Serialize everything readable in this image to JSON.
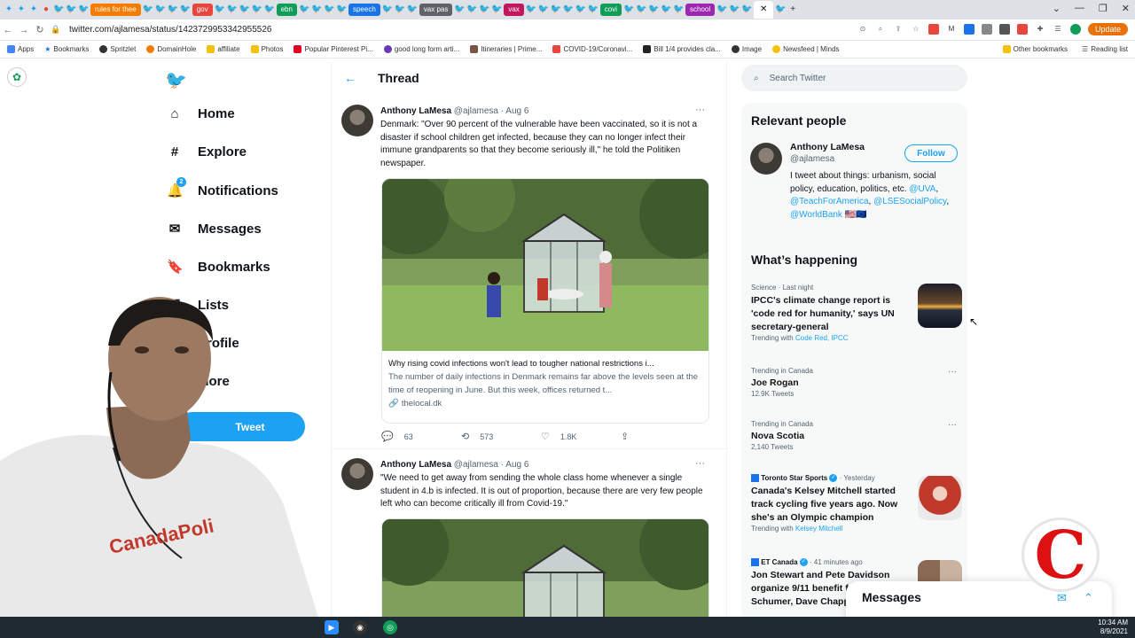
{
  "browser": {
    "tabs": [
      "rules for thee",
      "gov",
      "ebn",
      "speech",
      "vax pas",
      "vax",
      "covi",
      "school"
    ],
    "url": "twitter.com/ajlamesa/status/1423729953342955526",
    "update_label": "Update",
    "bookmarks": [
      "Apps",
      "Bookmarks",
      "Spritzlet",
      "DomainHole",
      "affiliate",
      "Photos",
      "Popular Pinterest Pi...",
      "good long form arti...",
      "Itineraries | Prime...",
      "COVID-19/Coronavi...",
      "Bill 1/4 provides cla...",
      "Image",
      "Newsfeed | Minds"
    ],
    "bookmarks_right": [
      "Other bookmarks",
      "Reading list"
    ],
    "colors": {
      "tab_red": "#e8453c",
      "tab_green": "#0f9d58",
      "tab_blue": "#1a73e8",
      "tab_purple": "#9c27b0",
      "tab_orange": "#f57c00",
      "tab_gray": "#5f6368"
    }
  },
  "sidebar": {
    "logo_icon": "twitter-bird-icon",
    "items": [
      {
        "label": "Home",
        "icon": "home-icon"
      },
      {
        "label": "Explore",
        "icon": "hashtag-icon"
      },
      {
        "label": "Notifications",
        "icon": "bell-icon",
        "badge": "2"
      },
      {
        "label": "Messages",
        "icon": "envelope-icon"
      },
      {
        "label": "Bookmarks",
        "icon": "bookmark-icon"
      },
      {
        "label": "Lists",
        "icon": "list-icon"
      },
      {
        "label": "Profile",
        "icon": "person-icon"
      },
      {
        "label": "More",
        "icon": "more-icon"
      }
    ],
    "tweet_button": "Tweet"
  },
  "main": {
    "header_title": "Thread",
    "tweets": [
      {
        "name": "Anthony LaMesa",
        "handle": "@ajlamesa",
        "date": "· Aug 6",
        "text": "Denmark: \"Over 90 percent of the vulnerable have been vaccinated, so it is not a disaster if school children get infected, because they can no longer infect their immune grandparents so that they become seriously ill,\" he told the Politiken newspaper.",
        "card_title": "Why rising covid infections won't lead to tougher national restrictions i...",
        "card_desc": "The number of daily infections in Denmark remains far above the levels seen at the time of reopening in June. But this week, offices returned t...",
        "card_domain": "thelocal.dk",
        "replies": "63",
        "retweets": "573",
        "likes": "1.8K"
      },
      {
        "name": "Anthony LaMesa",
        "handle": "@ajlamesa",
        "date": "· Aug 6",
        "text": "\"We need to get away from sending the whole class home whenever a single student in 4.b is infected. It is out of proportion, because there are very few people left who can become critically ill from Covid-19.\""
      }
    ]
  },
  "right": {
    "search_placeholder": "Search Twitter",
    "relevant": {
      "title": "Relevant people",
      "name": "Anthony LaMesa",
      "handle": "@ajlamesa",
      "follow": "Follow",
      "bio_text": "I tweet about things: urbanism, social policy, education, politics, etc.",
      "bio_links": [
        "@UVA",
        "@TeachForAmerica",
        "@LSESocialPolicy",
        "@WorldBank"
      ],
      "bio_flags": "🇺🇸🇪🇺"
    },
    "happening": {
      "title": "What’s happening",
      "trends": [
        {
          "meta": "Science · Last night",
          "title": "IPCC's climate change report is 'code red for humanity,' says UN secretary-general",
          "with_label": "Trending with",
          "with": "Code Red, IPCC"
        },
        {
          "meta": "Trending in Canada",
          "title": "Joe Rogan",
          "count": "12.9K Tweets"
        },
        {
          "meta": "Trending in Canada",
          "title": "Nova Scotia",
          "count": "2,140 Tweets"
        },
        {
          "meta": "Toronto Star Sports",
          "meta_suffix": "· Yesterday",
          "title": "Canada's Kelsey Mitchell started track cycling five years ago. Now she's an Olympic champion",
          "with_label": "Trending with",
          "with": "Kelsey Mitchell"
        },
        {
          "meta": "ET Canada",
          "meta_suffix": "· 41 minutes ago",
          "title": "Jon Stewart and Pete Davidson organize 9/11 benefit featuring Amy Schumer, Dave Chappelle..."
        }
      ]
    }
  },
  "messages_drawer": {
    "title": "Messages"
  },
  "overlay": {
    "logo_letter": "C",
    "shirt_text": "CanadaPoli"
  },
  "taskbar": {
    "time": "10:34 AM",
    "date": "8/9/2021"
  }
}
